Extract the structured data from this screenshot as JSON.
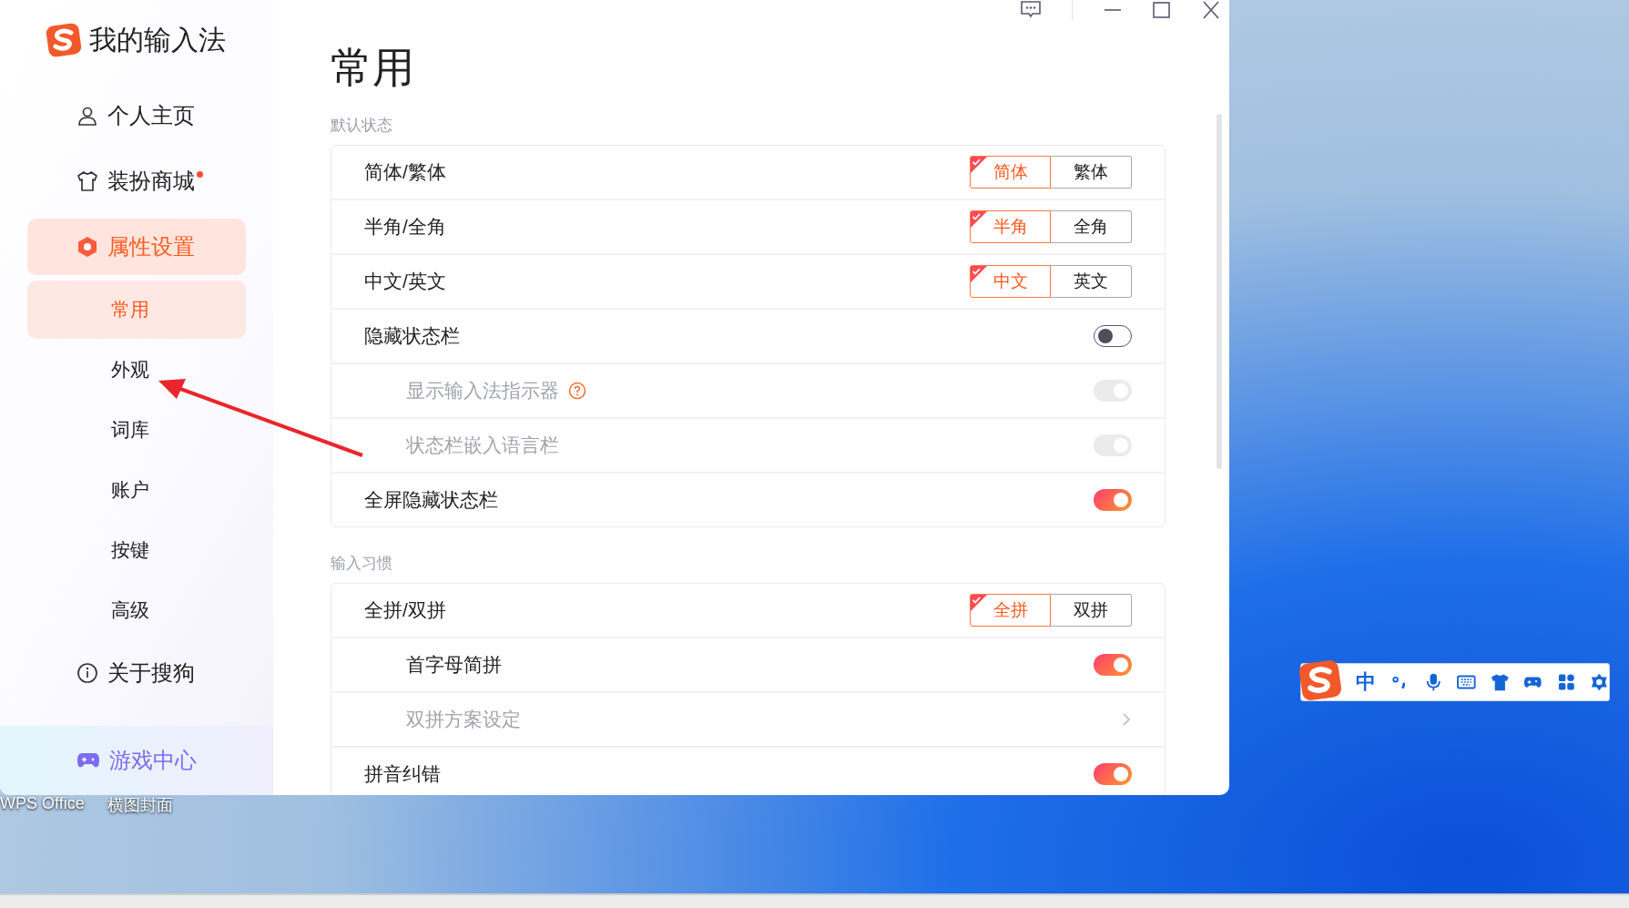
{
  "app": {
    "title": "我的输入法"
  },
  "sidebar": {
    "items": [
      {
        "label": "个人主页",
        "selected": false
      },
      {
        "label": "装扮商城",
        "selected": false,
        "dot": true
      },
      {
        "label": "属性设置",
        "selected": true,
        "children": [
          {
            "label": "常用",
            "selected": true
          },
          {
            "label": "外观",
            "selected": false
          },
          {
            "label": "词库",
            "selected": false
          },
          {
            "label": "账户",
            "selected": false
          },
          {
            "label": "按键",
            "selected": false
          },
          {
            "label": "高级",
            "selected": false
          }
        ]
      },
      {
        "label": "关于搜狗",
        "selected": false
      }
    ],
    "footer": {
      "label": "游戏中心"
    }
  },
  "main": {
    "title": "常用",
    "sections": [
      {
        "title": "默认状态",
        "rows": [
          {
            "kind": "segmented",
            "label": "简体/繁体",
            "options": [
              {
                "label": "简体",
                "selected": true
              },
              {
                "label": "繁体",
                "selected": false
              }
            ]
          },
          {
            "kind": "segmented",
            "label": "半角/全角",
            "options": [
              {
                "label": "半角",
                "selected": true
              },
              {
                "label": "全角",
                "selected": false
              }
            ]
          },
          {
            "kind": "segmented",
            "label": "中文/英文",
            "options": [
              {
                "label": "中文",
                "selected": true
              },
              {
                "label": "英文",
                "selected": false
              }
            ]
          },
          {
            "kind": "toggle",
            "label": "隐藏状态栏",
            "on": false,
            "disabled": false,
            "children": [
              {
                "kind": "toggle",
                "label": "显示输入法指示器",
                "on": true,
                "disabled": true,
                "help": true
              },
              {
                "kind": "toggle",
                "label": "状态栏嵌入语言栏",
                "on": true,
                "disabled": true
              }
            ]
          },
          {
            "kind": "toggle",
            "label": "全屏隐藏状态栏",
            "on": true,
            "disabled": false
          }
        ]
      },
      {
        "title": "输入习惯",
        "rows": [
          {
            "kind": "segmented",
            "label": "全拼/双拼",
            "options": [
              {
                "label": "全拼",
                "selected": true
              },
              {
                "label": "双拼",
                "selected": false
              }
            ],
            "children": [
              {
                "kind": "toggle",
                "label": "首字母简拼",
                "on": true,
                "disabled": false
              },
              {
                "kind": "link",
                "label": "双拼方案设定",
                "disabled": true
              }
            ]
          },
          {
            "kind": "toggle",
            "label": "拼音纠错",
            "on": true,
            "disabled": false
          }
        ]
      }
    ]
  },
  "desktop": {
    "icons": [
      {
        "label": "WPS Office"
      },
      {
        "label": "横图封面"
      }
    ]
  },
  "ime_toolbar": {
    "mode": "中"
  }
}
